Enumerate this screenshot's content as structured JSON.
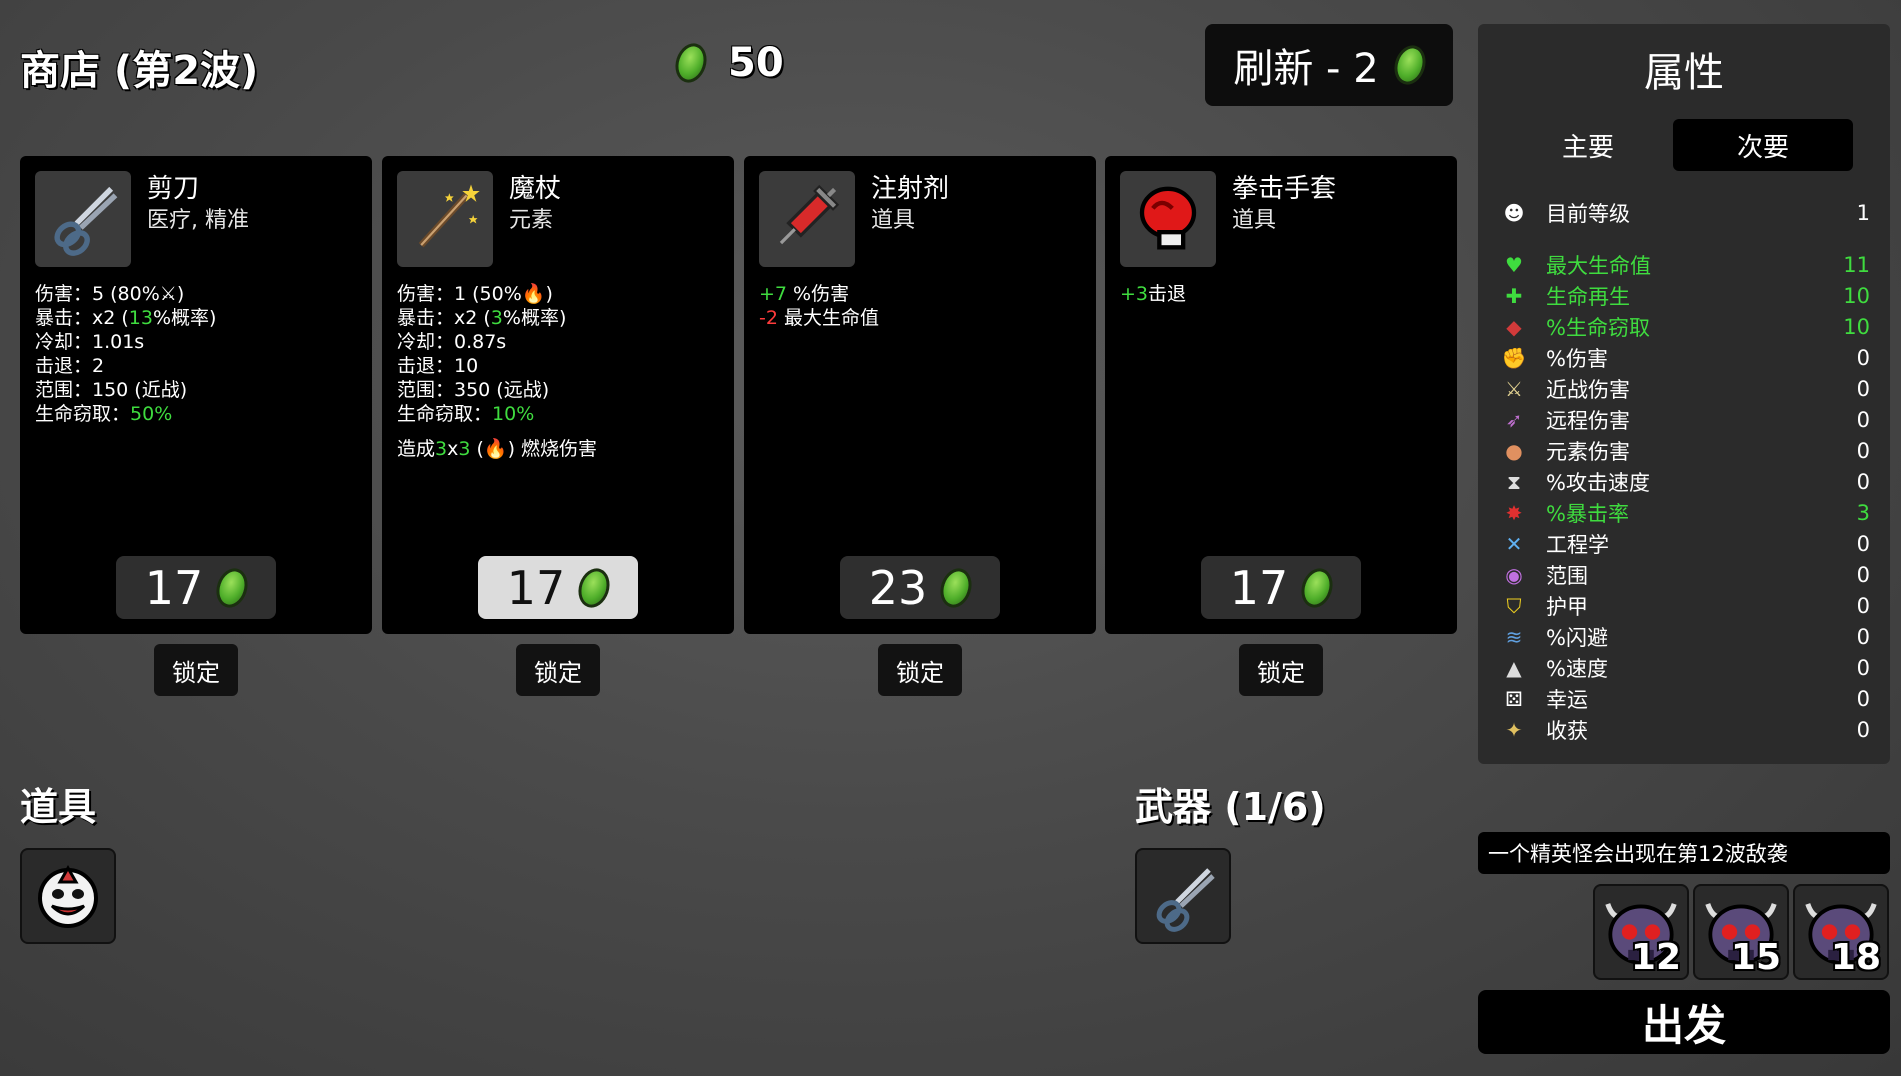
{
  "header": {
    "shop_title": "商店 (第2波)",
    "materials": "50",
    "refresh_label": "刷新 - 2"
  },
  "shop_items": [
    {
      "name": "剪刀",
      "tags": "医疗, 精准",
      "stats": [
        {
          "parts": [
            {
              "t": "伤害：5 (80%"
            },
            {
              "t": "⚔"
            },
            {
              "t": ")"
            }
          ]
        },
        {
          "parts": [
            {
              "t": "暴击：x2 ("
            },
            {
              "t": "13",
              "c": "green"
            },
            {
              "t": "%概率)"
            }
          ]
        },
        {
          "parts": [
            {
              "t": "冷却：1.01s"
            }
          ]
        },
        {
          "parts": [
            {
              "t": "击退：2"
            }
          ]
        },
        {
          "parts": [
            {
              "t": "范围：150 (近战)"
            }
          ]
        },
        {
          "parts": [
            {
              "t": "生命窃取："
            },
            {
              "t": "50%",
              "c": "green"
            }
          ]
        }
      ],
      "extra": [],
      "price": "17",
      "price_style": "dark",
      "lock_label": "锁定"
    },
    {
      "name": "魔杖",
      "tags": "元素",
      "stats": [
        {
          "parts": [
            {
              "t": "伤害：1 (50%"
            },
            {
              "t": "🔥"
            },
            {
              "t": ")"
            }
          ]
        },
        {
          "parts": [
            {
              "t": "暴击：x2 ("
            },
            {
              "t": "3",
              "c": "green"
            },
            {
              "t": "%概率)"
            }
          ]
        },
        {
          "parts": [
            {
              "t": "冷却：0.87s"
            }
          ]
        },
        {
          "parts": [
            {
              "t": "击退：10"
            }
          ]
        },
        {
          "parts": [
            {
              "t": "范围：350 (远战)"
            }
          ]
        },
        {
          "parts": [
            {
              "t": "生命窃取："
            },
            {
              "t": "10%",
              "c": "green"
            }
          ]
        }
      ],
      "extra": [
        {
          "parts": [
            {
              "t": "造成"
            },
            {
              "t": "3",
              "c": "green"
            },
            {
              "t": "x"
            },
            {
              "t": "3",
              "c": "green"
            },
            {
              "t": " ("
            },
            {
              "t": "🔥"
            },
            {
              "t": ") 燃烧伤害"
            }
          ]
        }
      ],
      "price": "17",
      "price_style": "light",
      "lock_label": "锁定"
    },
    {
      "name": "注射剂",
      "tags": "道具",
      "stats": [
        {
          "parts": [
            {
              "t": "+7",
              "c": "green"
            },
            {
              "t": " %伤害"
            }
          ]
        },
        {
          "parts": [
            {
              "t": "-2",
              "c": "red"
            },
            {
              "t": " 最大生命值"
            }
          ]
        }
      ],
      "extra": [],
      "price": "23",
      "price_style": "dark",
      "lock_label": "锁定"
    },
    {
      "name": "拳击手套",
      "tags": "道具",
      "stats": [
        {
          "parts": [
            {
              "t": "+3",
              "c": "green"
            },
            {
              "t": "击退"
            }
          ]
        }
      ],
      "extra": [],
      "price": "17",
      "price_style": "dark",
      "lock_label": "锁定"
    }
  ],
  "stats_panel": {
    "title": "属性",
    "tab_main": "主要",
    "tab_secondary": "次要",
    "level_label": "目前等级",
    "level_value": "1",
    "rows": [
      {
        "icon": "♥",
        "icon_color": "#3fdc3f",
        "label": "最大生命值",
        "value": "11",
        "highlight": true
      },
      {
        "icon": "✚",
        "icon_color": "#3fdc3f",
        "label": "生命再生",
        "value": "10",
        "highlight": true
      },
      {
        "icon": "◆",
        "icon_color": "#d23a3a",
        "label": "%生命窃取",
        "value": "10",
        "highlight": true
      },
      {
        "icon": "✊",
        "icon_color": "#e06060",
        "label": "%伤害",
        "value": "0",
        "highlight": false
      },
      {
        "icon": "⚔",
        "icon_color": "#e0d090",
        "label": "近战伤害",
        "value": "0",
        "highlight": false
      },
      {
        "icon": "➶",
        "icon_color": "#c070d0",
        "label": "远程伤害",
        "value": "0",
        "highlight": false
      },
      {
        "icon": "●",
        "icon_color": "#e09060",
        "label": "元素伤害",
        "value": "0",
        "highlight": false
      },
      {
        "icon": "⧗",
        "icon_color": "#dddddd",
        "label": "%攻击速度",
        "value": "0",
        "highlight": false
      },
      {
        "icon": "✸",
        "icon_color": "#e03030",
        "label": "%暴击率",
        "value": "3",
        "highlight": true
      },
      {
        "icon": "✕",
        "icon_color": "#60b0f0",
        "label": "工程学",
        "value": "0",
        "highlight": false
      },
      {
        "icon": "◉",
        "icon_color": "#c070e0",
        "label": "范围",
        "value": "0",
        "highlight": false
      },
      {
        "icon": "⛉",
        "icon_color": "#f0d020",
        "label": "护甲",
        "value": "0",
        "highlight": false
      },
      {
        "icon": "≋",
        "icon_color": "#60a0e0",
        "label": "%闪避",
        "value": "0",
        "highlight": false
      },
      {
        "icon": "▲",
        "icon_color": "#dddddd",
        "label": "%速度",
        "value": "0",
        "highlight": false
      },
      {
        "icon": "⚄",
        "icon_color": "#ffffff",
        "label": "幸运",
        "value": "0",
        "highlight": false
      },
      {
        "icon": "✦",
        "icon_color": "#e0c060",
        "label": "收获",
        "value": "0",
        "highlight": false
      }
    ]
  },
  "inventory": {
    "items_title": "道具",
    "weapons_title": "武器 (1/6)"
  },
  "waves": {
    "elite_notice": "一个精英怪会出现在第12波敌袭",
    "wave_numbers": [
      "12",
      "15",
      "18"
    ],
    "go_label": "出发"
  },
  "colors": {
    "highlight_green": "#3fdc3f",
    "negative_red": "#ff3b3b",
    "material_gem": "#4fae2a"
  }
}
